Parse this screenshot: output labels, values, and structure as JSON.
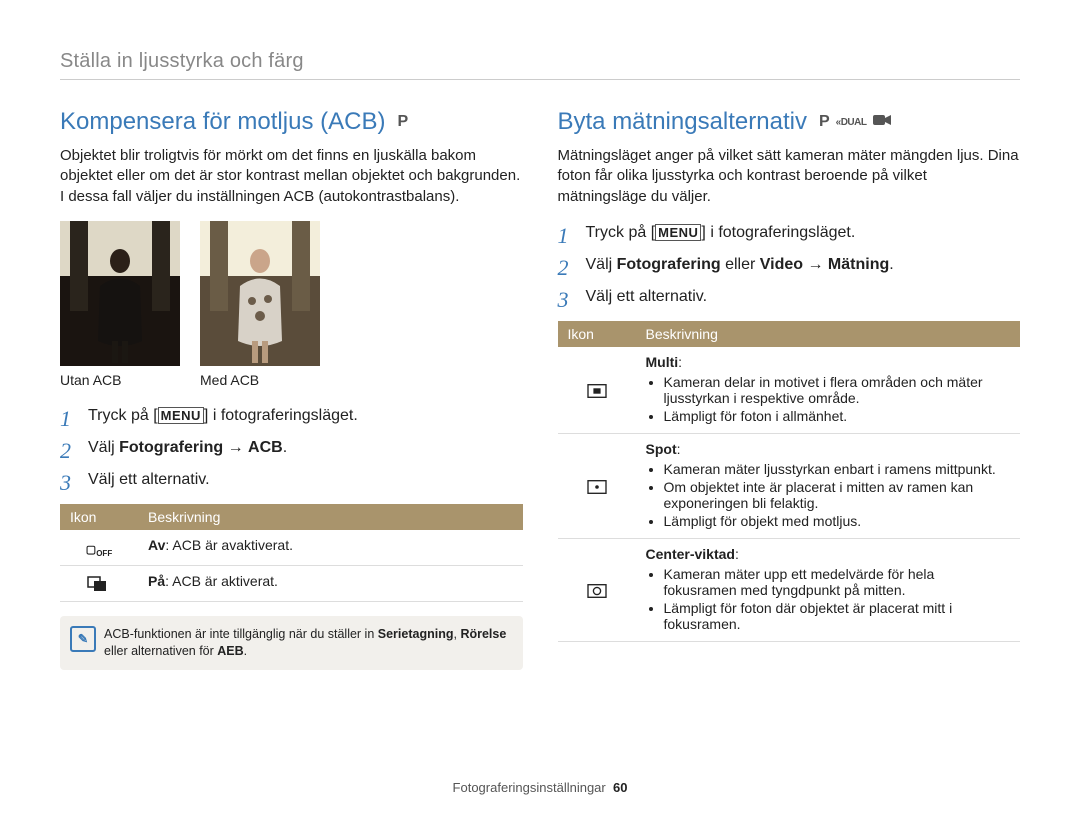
{
  "breadcrumb": "Ställa in ljusstyrka och färg",
  "left": {
    "title": "Kompensera för motljus (ACB)",
    "mode_label": "P",
    "intro": "Objektet blir troligtvis för mörkt om det finns en ljuskälla bakom objektet eller om det är stor kontrast mellan objektet och bakgrunden. I dessa fall väljer du inställningen ACB (autokontrastbalans).",
    "caption_without": "Utan ACB",
    "caption_with": "Med ACB",
    "step1_pre": "Tryck på [",
    "step1_menu": "MENU",
    "step1_post": "] i fotograferingsläget.",
    "step2_a": "Välj ",
    "step2_b": "Fotografering",
    "step2_arrow": " → ",
    "step2_c": "ACB",
    "step2_d": ".",
    "step3": "Välj ett alternativ.",
    "table": {
      "h_icon": "Ikon",
      "h_desc": "Beskrivning",
      "r1_label": "Av",
      "r1_text": ": ACB är avaktiverat.",
      "r2_label": "På",
      "r2_text": ": ACB är aktiverat."
    },
    "note_a": "ACB-funktionen är inte tillgänglig när du ställer in ",
    "note_b": "Serietagning",
    "note_c": ", ",
    "note_d": "Rörelse",
    "note_e": " eller alternativen för ",
    "note_f": "AEB",
    "note_g": "."
  },
  "right": {
    "title": "Byta mätningsalternativ",
    "mode_label": "P",
    "intro": "Mätningsläget anger på vilket sätt kameran mäter mängden ljus. Dina foton får olika ljusstyrka och kontrast beroende på vilket mätningsläge du väljer.",
    "step1_pre": "Tryck på [",
    "step1_menu": "MENU",
    "step1_post": "] i fotograferingsläget.",
    "step2_a": "Välj ",
    "step2_b": "Fotografering",
    "step2_c": " eller ",
    "step2_d": "Video",
    "step2_arrow": " → ",
    "step2_e": "Mätning",
    "step2_f": ".",
    "step3": "Välj ett alternativ.",
    "table": {
      "h_icon": "Ikon",
      "h_desc": "Beskrivning",
      "r1_title": "Multi",
      "r1_b1": "Kameran delar in motivet i flera områden och mäter ljusstyrkan i respektive område.",
      "r1_b2": "Lämpligt för foton i allmänhet.",
      "r2_title": "Spot",
      "r2_b1": "Kameran mäter ljusstyrkan enbart i ramens mittpunkt.",
      "r2_b2": "Om objektet inte är placerat i mitten av ramen kan exponeringen bli felaktig.",
      "r2_b3": "Lämpligt för objekt med motljus.",
      "r3_title": "Center-viktad",
      "r3_b1": "Kameran mäter upp ett medelvärde för hela fokusramen med tyngdpunkt på mitten.",
      "r3_b2": "Lämpligt för foton där objektet är placerat mitt i fokusramen."
    }
  },
  "footer_label": "Fotograferingsinställningar",
  "page_number": "60"
}
